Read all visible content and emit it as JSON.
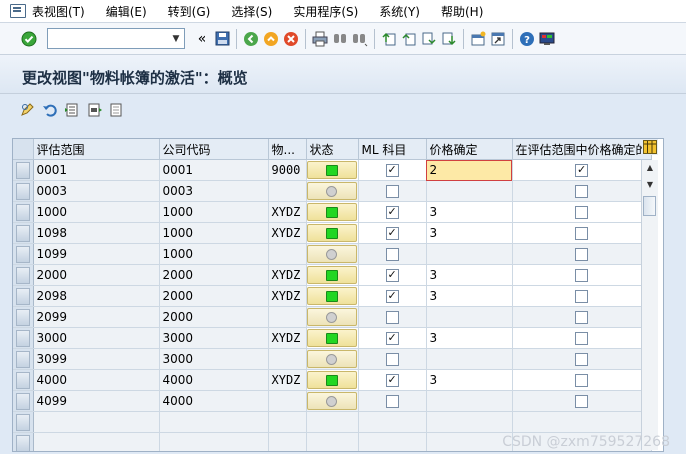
{
  "menu": [
    "表视图(T)",
    "编辑(E)",
    "转到(G)",
    "选择(S)",
    "实用程序(S)",
    "系统(Y)",
    "帮助(H)"
  ],
  "toolbar": {
    "command_value": "",
    "icons": [
      "ok-icon",
      "save-icon",
      "back-icon",
      "exit-icon",
      "cancel-icon",
      "print-icon",
      "find-icon",
      "find-next-icon",
      "first-page-icon",
      "prev-page-icon",
      "next-page-icon",
      "last-page-icon",
      "new-session-icon",
      "shortcut-icon",
      "help-icon",
      "layout-icon"
    ]
  },
  "page_title": "更改视图\"物料帐簿的激活\"：概览",
  "app_toolbar": [
    "change-icon",
    "undo-icon",
    "select-all-icon",
    "select-block-icon",
    "deselect-all-icon"
  ],
  "table": {
    "headers": [
      "评估范围",
      "公司代码",
      "物...",
      "状态",
      "ML 科目",
      "价格确定",
      "在评估范围中价格确定的"
    ],
    "rows": [
      {
        "area": "0001",
        "company": "0001",
        "mat": "9000",
        "active": true,
        "ml": true,
        "price": "2",
        "fixed": true
      },
      {
        "area": "0003",
        "company": "0003",
        "mat": "",
        "active": false,
        "ml": false,
        "price": "",
        "fixed": false
      },
      {
        "area": "1000",
        "company": "1000",
        "mat": "XYDZ",
        "active": true,
        "ml": true,
        "price": "3",
        "fixed": false
      },
      {
        "area": "1098",
        "company": "1000",
        "mat": "XYDZ",
        "active": true,
        "ml": true,
        "price": "3",
        "fixed": false
      },
      {
        "area": "1099",
        "company": "1000",
        "mat": "",
        "active": false,
        "ml": false,
        "price": "",
        "fixed": false
      },
      {
        "area": "2000",
        "company": "2000",
        "mat": "XYDZ",
        "active": true,
        "ml": true,
        "price": "3",
        "fixed": false
      },
      {
        "area": "2098",
        "company": "2000",
        "mat": "XYDZ",
        "active": true,
        "ml": true,
        "price": "3",
        "fixed": false
      },
      {
        "area": "2099",
        "company": "2000",
        "mat": "",
        "active": false,
        "ml": false,
        "price": "",
        "fixed": false
      },
      {
        "area": "3000",
        "company": "3000",
        "mat": "XYDZ",
        "active": true,
        "ml": true,
        "price": "3",
        "fixed": false
      },
      {
        "area": "3099",
        "company": "3000",
        "mat": "",
        "active": false,
        "ml": false,
        "price": "",
        "fixed": false
      },
      {
        "area": "4000",
        "company": "4000",
        "mat": "XYDZ",
        "active": true,
        "ml": true,
        "price": "3",
        "fixed": false
      },
      {
        "area": "4099",
        "company": "4000",
        "mat": "",
        "active": false,
        "ml": false,
        "price": "",
        "fixed": false
      }
    ],
    "empty_rows": 2
  },
  "watermark": "CSDN @zxm759527268"
}
